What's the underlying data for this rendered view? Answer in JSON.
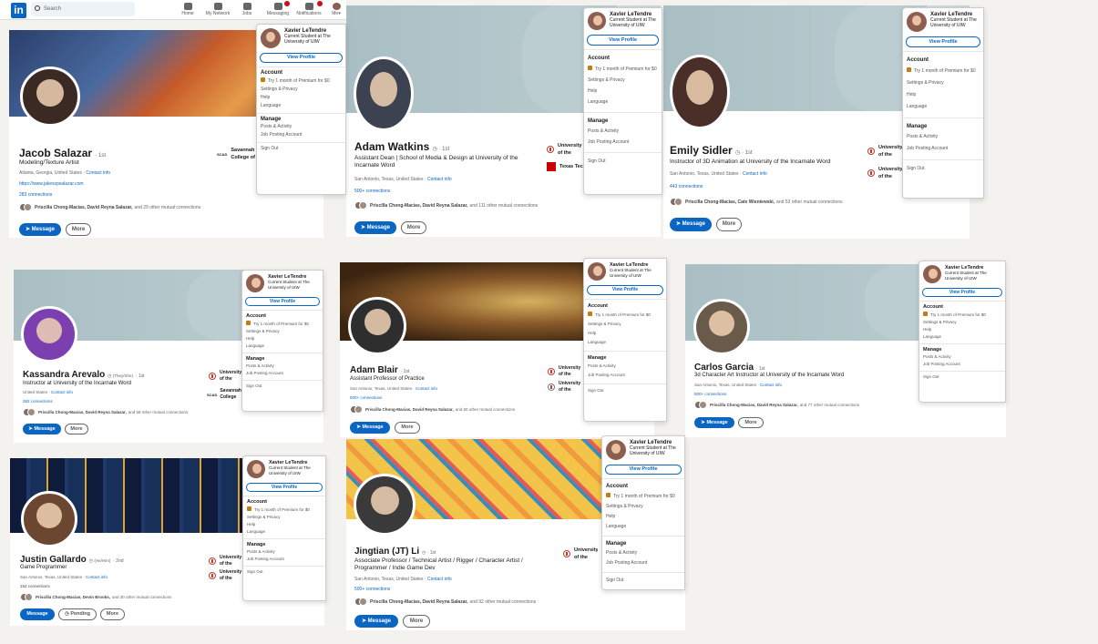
{
  "topbar": {
    "logo": "in",
    "search_placeholder": "Search",
    "nav": [
      {
        "label": "Home",
        "icon": "home-icon"
      },
      {
        "label": "My Network",
        "icon": "network-icon"
      },
      {
        "label": "Jobs",
        "icon": "jobs-icon"
      },
      {
        "label": "Messaging",
        "icon": "messaging-icon"
      },
      {
        "label": "Notifications",
        "icon": "bell-icon"
      },
      {
        "label": "Me▾",
        "icon": "avatar"
      }
    ]
  },
  "menu": {
    "name": "Xavier LeTendre",
    "sub1": "Current Student at The",
    "sub2": "University of UIW",
    "view_profile": "View Profile",
    "account": "Account",
    "premium": "Try 1 month of Premium for $0",
    "settings": "Settings & Privacy",
    "help": "Help",
    "language": "Language",
    "manage": "Manage",
    "posts": "Posts & Activity",
    "jobs": "Job Posting Account",
    "signout": "Sign Out"
  },
  "profiles": {
    "jacob": {
      "name": "Jacob Salazar",
      "degree": "· 1st",
      "headline": "Modeling/Texture Artist",
      "location": "Atlanta, Georgia, United States ·",
      "contact": "Contact info",
      "website": "https://www.jakesvpsalazar.com",
      "connections": "283 connections",
      "mutual_names": "Priscilla Chong-Macias, David Reyna Salazar,",
      "mutual_rest": "and 29 other mutual connections",
      "edu": "Savannah College of Art and Design",
      "edu_abbr": "SCAD",
      "message": "Message",
      "more": "More"
    },
    "adam_w": {
      "name": "Adam Watkins",
      "degree": "· 1st",
      "headline1": "Assistant Dean | School of Media & Design at University of the",
      "headline2": "Incarnate Word",
      "location": "San Antonio, Texas, United States ·",
      "contact": "Contact info",
      "connections": "500+ connections",
      "mutual_names": "Priscilla Chong-Macias, David Reyna Salazar,",
      "mutual_rest": "and 111 other mutual connections",
      "edu1": "University of the Incarnate Word",
      "edu2": "Texas Tech",
      "message": "Message",
      "more": "More"
    },
    "emily": {
      "name": "Emily Sidler",
      "degree": "· 1st",
      "headline": "Instructor of 3D Animation at University of the Incarnate Word",
      "location": "San Antonio, Texas, United States ·",
      "contact": "Contact info",
      "connections": "443 connections",
      "mutual_names": "Priscilla Chong-Macias, Cate Wisniewski,",
      "mutual_rest": "and 53 other mutual connections",
      "edu1": "University of the Incarnate Word",
      "edu2": "University of the Incarnate Word",
      "message": "Message",
      "more": "More"
    },
    "kassandra": {
      "name": "Kassandra Arevalo",
      "pronouns": "(They/She)",
      "degree": "· 1st",
      "headline": "Instructor at University of the Incarnate Word",
      "location": "United States ·",
      "contact": "Contact info",
      "connections": "382 connections",
      "mutual_names": "Priscilla Chong-Macias, David Reyna Salazar,",
      "mutual_rest": "and 58 other mutual connections",
      "edu1": "University of the Incarnate Word",
      "edu2": "Savannah College of Art and Design",
      "edu2_abbr": "SCAD",
      "message": "Message",
      "more": "More"
    },
    "adam_b": {
      "name": "Adam Blair",
      "degree": "· 1st",
      "headline": "Assistant Professor of Practice",
      "location": "San Antonio, Texas, United States ·",
      "contact": "Contact info",
      "connections": "500+ connections",
      "mutual_names": "Priscilla Chong-Macias, David Reyna Salazar,",
      "mutual_rest": "and 60 other mutual connections",
      "edu1": "University of the Incarnate Word",
      "edu2": "University of the Incarnate Word",
      "message": "Message",
      "more": "More"
    },
    "carlos": {
      "name": "Carlos Garcia",
      "degree": "· 1st",
      "headline": "3d Character Art Instructor at University of the Incarnate Word",
      "location": "San Antonio, Texas, United States ·",
      "contact": "Contact info",
      "connections": "500+ connections",
      "mutual_names": "Priscilla Chong-Macias, David Reyna Salazar,",
      "mutual_rest": "and 77 other mutual connections",
      "message": "Message",
      "more": "More"
    },
    "justin": {
      "name": "Justin Gallardo",
      "pronouns": "(He/Him)",
      "degree": "· 2nd",
      "headline": "Game Programmer",
      "location": "San Antonio, Texas, United States ·",
      "contact": "Contact info",
      "connections": "152 connections",
      "mutual_names": "Priscilla Chong-Macias, Devin Brooks,",
      "mutual_rest": "and 30 other mutual connections",
      "edu1": "University of the Incarnate Word",
      "edu2": "University of the Incarnate Word",
      "message": "Message",
      "pending": "Pending",
      "more": "More"
    },
    "jt": {
      "name": "Jingtian (JT) Li",
      "degree": "· 1st",
      "headline1": "Associate Professor / Technical Artist / Rigger / Character Artist /",
      "headline2": "Programmer / Indie Game Dev",
      "location": "San Antonio, Texas, United States ·",
      "contact": "Contact info",
      "connections": "500+ connections",
      "mutual_names": "Priscilla Chong-Macias, David Reyna Salazar,",
      "mutual_rest": "and 92 other mutual connections",
      "edu1": "University of the Incarnate Word",
      "message": "Message",
      "more": "More"
    }
  },
  "colors": {
    "brand": "#0a66c2",
    "premium": "#c37d16",
    "badge": "#cc1016"
  }
}
